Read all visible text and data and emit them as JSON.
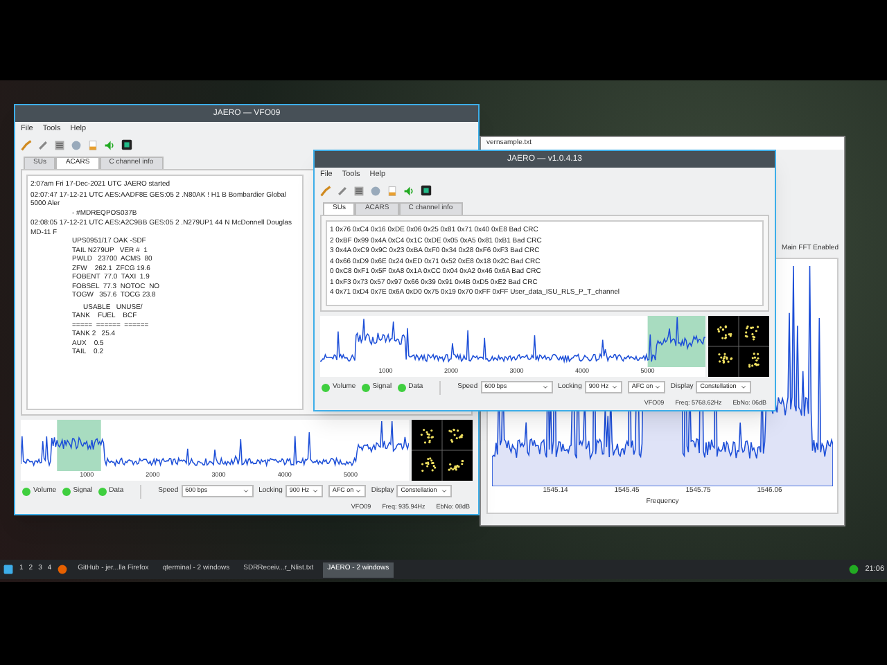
{
  "back_window": {
    "title_fragment": "vernsample.txt",
    "fft_toggle": {
      "label": "Main FFT Enabled"
    },
    "xticks": [
      "1545.14",
      "1545.45",
      "1545.75",
      "1546.06"
    ],
    "xlabel": "Frequency"
  },
  "left_window": {
    "title": "JAERO — VFO09",
    "menu": [
      "File",
      "Tools",
      "Help"
    ],
    "tabs": [
      {
        "label": "SUs",
        "selected": false
      },
      {
        "label": "ACARS",
        "selected": true
      },
      {
        "label": "C channel info",
        "selected": false
      }
    ],
    "log": [
      {
        "kind": "header",
        "text": "2:07am Fri 17-Dec-2021 UTC JAERO started"
      },
      {
        "kind": "header",
        "text": "02:07:47 17-12-21 UTC AES:AADF8E GES:05 2 .N80AK ! H1 B Bombardier Global 5000 Aler"
      },
      {
        "kind": "detail",
        "text": "- #MDREQPOS037B"
      },
      {
        "kind": "header",
        "text": "02:08:05 17-12-21 UTC AES:A2C9BB GES:05 2 .N279UP1 44 N McDonnell Douglas MD-11 F"
      },
      {
        "kind": "detail",
        "text": "UPS0951/17 OAK -SDF"
      },
      {
        "kind": "detail",
        "text": "TAIL N279UP   VER #  1"
      },
      {
        "kind": "detail",
        "text": "PWLD   23700  ACMS  80"
      },
      {
        "kind": "detail",
        "text": "ZFW    262.1  ZFCG 19.6"
      },
      {
        "kind": "detail",
        "text": "FOBENT  77.0  TAXI  1.9"
      },
      {
        "kind": "detail",
        "text": "FOBSEL  77.3  NOTOC  NO"
      },
      {
        "kind": "detail",
        "text": "TOGW   357.6  TOCG 23.8"
      },
      {
        "kind": "table",
        "text": "USABLE   UNUSE/"
      },
      {
        "kind": "detail",
        "text": "TANK    FUEL    BCF"
      },
      {
        "kind": "detail",
        "text": "=====  ======  ======"
      },
      {
        "kind": "detail",
        "text": "TANK 2   25.4"
      },
      {
        "kind": "detail",
        "text": "AUX    0.5"
      },
      {
        "kind": "detail",
        "text": "TAIL    0.2"
      }
    ],
    "ticks": [
      "1000",
      "2000",
      "3000",
      "4000",
      "5000"
    ],
    "indicators": [
      {
        "label": "Volume",
        "on": true
      },
      {
        "label": "Signal",
        "on": true
      },
      {
        "label": "Data",
        "on": true
      }
    ],
    "controls": [
      {
        "label": "Speed",
        "value": "600 bps"
      },
      {
        "label": "Locking",
        "value": "900 Hz"
      },
      {
        "value": "AFC on"
      },
      {
        "label": "Display",
        "value": "Constellation"
      }
    ],
    "status": [
      "VFO09",
      "Freq: 935.94Hz",
      "EbNo: 08dB"
    ]
  },
  "right_window": {
    "title": "JAERO — v1.0.4.13",
    "menu": [
      "File",
      "Tools",
      "Help"
    ],
    "tabs": [
      {
        "label": "SUs",
        "selected": true
      },
      {
        "label": "ACARS",
        "selected": false
      },
      {
        "label": "C channel info",
        "selected": false
      }
    ],
    "log": [
      {
        "kind": "header",
        "text": "1 0x76 0xC4 0x16 0xDE 0x06 0x25 0x81 0x71 0x40 0xE8 Bad CRC"
      },
      {
        "kind": "header",
        "text": "2 0xBF 0x99 0x4A 0xC4 0x1C 0xDE 0x05 0xA5 0x81 0xB1 Bad CRC"
      },
      {
        "kind": "header",
        "text": "3 0x4A 0xC9 0x9C 0x23 0xBA 0xF0 0x34 0x28 0xF6 0xF3 Bad CRC"
      },
      {
        "kind": "header",
        "text": "4 0x66 0xD9 0x6E 0x24 0xED 0x71 0x52 0xE8 0x18 0x2C Bad CRC"
      },
      {
        "kind": "header",
        "text": "0 0xC8 0xF1 0x5F 0xA8 0x1A 0xCC 0x04 0xA2 0x46 0x6A Bad CRC"
      },
      {
        "kind": "header",
        "text": "1 0xF3 0x73 0x57 0x97 0x66 0x39 0x91 0x4B 0xD5 0xE2 Bad CRC"
      },
      {
        "kind": "header",
        "text": "4 0x71 0xD4 0x7E 0x6A 0xD0 0x75 0x19 0x70 0xFF 0xFF User_data_ISU_RLS_P_T_channel"
      }
    ],
    "ticks": [
      "1000",
      "2000",
      "3000",
      "4000",
      "5000"
    ],
    "indicators": [
      {
        "label": "Volume",
        "on": true
      },
      {
        "label": "Signal",
        "on": true
      },
      {
        "label": "Data",
        "on": true
      }
    ],
    "controls": [
      {
        "label": "Speed",
        "value": "600 bps"
      },
      {
        "label": "Locking",
        "value": "900 Hz"
      },
      {
        "value": "AFC on"
      },
      {
        "label": "Display",
        "value": "Constellation"
      }
    ],
    "status": [
      "VFO09",
      "Freq: 5768.62Hz",
      "EbNo: 06dB"
    ]
  },
  "taskbar": {
    "workspaces": [
      "1",
      "2",
      "3",
      "4"
    ],
    "tasks": [
      {
        "label": "GitHub - jer...lla Firefox",
        "selected": false
      },
      {
        "label": "qterminal - 2 windows",
        "selected": false
      },
      {
        "label": "SDRReceiv...r_Nlist.txt",
        "selected": false
      },
      {
        "label": "JAERO - 2 windows",
        "selected": true
      }
    ],
    "clock": "21:06"
  }
}
